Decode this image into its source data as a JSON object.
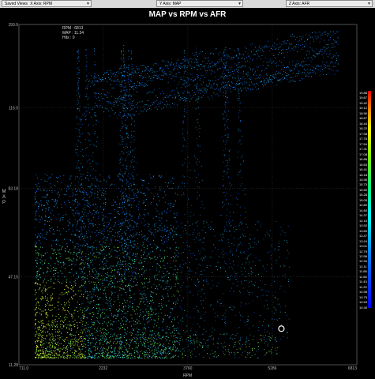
{
  "toolbar": {
    "saved_views_label": "Saved Views",
    "saved_views_value": "X Axis: RPM",
    "y_axis_value": "Y Axis: MAP",
    "z_axis_value": "Z Axis: AFR"
  },
  "info": {
    "rpm_label": "RPM : 6813",
    "map_label": "MAP : 11.34",
    "hits_label": "Hits : 0"
  },
  "colors": {
    "background": "#000000",
    "grid": "#333333",
    "axis": "#666666",
    "cursor": "#ffffff"
  },
  "chart_data": {
    "type": "scatter",
    "title": "MAP vs RPM vs AFR",
    "xlabel": "RPM",
    "ylabel": "M\nA\nP",
    "zlabel": "",
    "xlim": [
      711.0,
      6813
    ],
    "ylim": [
      11.28,
      150.0
    ],
    "x_ticks": [
      "711.0",
      "2232",
      "3760",
      "5286",
      "6813"
    ],
    "x_tick_values": [
      711.0,
      2232,
      3760,
      5286,
      6813
    ],
    "y_ticks": [
      "150.0",
      "116.0",
      "83.18",
      "47.15",
      "11.28"
    ],
    "y_tick_values": [
      150.0,
      116.0,
      83.18,
      47.15,
      11.28
    ],
    "grid": true,
    "colorbar": {
      "ticks": [
        "19.88",
        "19.67",
        "19.42",
        "19.12",
        "18.90",
        "18.67",
        "18.44",
        "18.22",
        "17.98",
        "17.76",
        "17.54",
        "17.31",
        "17.08",
        "16.86",
        "16.63",
        "16.41",
        "16.18",
        "15.96",
        "15.73",
        "15.50",
        "15.28",
        "15.05",
        "14.82",
        "14.60",
        "14.37",
        "14.15",
        "13.92",
        "13.69",
        "13.47",
        "13.24",
        "13.01",
        "12.79",
        "12.56",
        "12.34",
        "12.11",
        "11.88",
        "11.66",
        "11.43",
        "11.20",
        "10.98",
        "10.75",
        "10.53",
        "10.30"
      ],
      "max": 19.88,
      "min": 10.3,
      "colors": [
        "#ff0000",
        "#ff8000",
        "#ffff00",
        "#80ff00",
        "#00ff80",
        "#00ffff",
        "#0080ff",
        "#0000ff"
      ]
    },
    "cursor": {
      "x": 5450,
      "y": 26
    }
  }
}
